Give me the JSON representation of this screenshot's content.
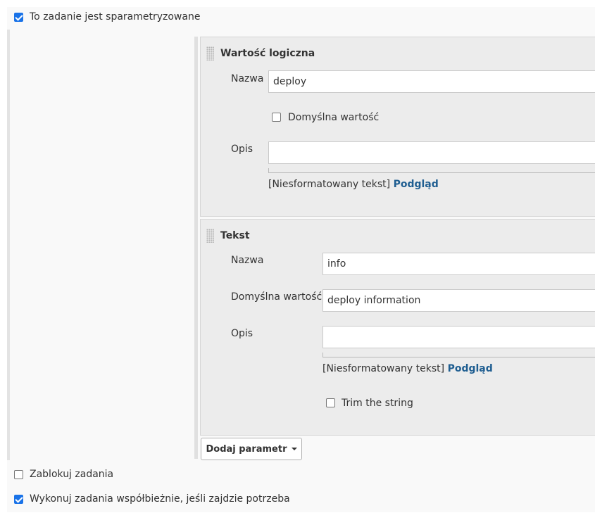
{
  "parameterized": {
    "label": "To zadanie jest sparametryzowane",
    "checked": true
  },
  "params": [
    {
      "title": "Wartość logiczna",
      "name_label": "Nazwa",
      "name_value": "deploy",
      "default_checkbox_label": "Domyślna wartość",
      "default_checked": false,
      "desc_label": "Opis",
      "desc_value": "",
      "format_text": "[Niesformatowany tekst]",
      "preview_link": "Podgląd"
    },
    {
      "title": "Tekst",
      "name_label": "Nazwa",
      "name_value": "info",
      "default_label": "Domyślna wartość",
      "default_value": "deploy information",
      "desc_label": "Opis",
      "desc_value": "",
      "format_text": "[Niesformatowany tekst]",
      "preview_link": "Podgląd",
      "trim_label": "Trim the string",
      "trim_checked": false
    }
  ],
  "add_param_button": "Dodaj parametr",
  "block_builds": {
    "label": "Zablokuj zadania",
    "checked": false
  },
  "concurrent_builds": {
    "label": "Wykonuj zadania współbieżnie, jeśli zajdzie potrzeba",
    "checked": true
  },
  "colors": {
    "accent": "#1a73e8",
    "link": "#1f5e91",
    "panel": "#ececec"
  }
}
